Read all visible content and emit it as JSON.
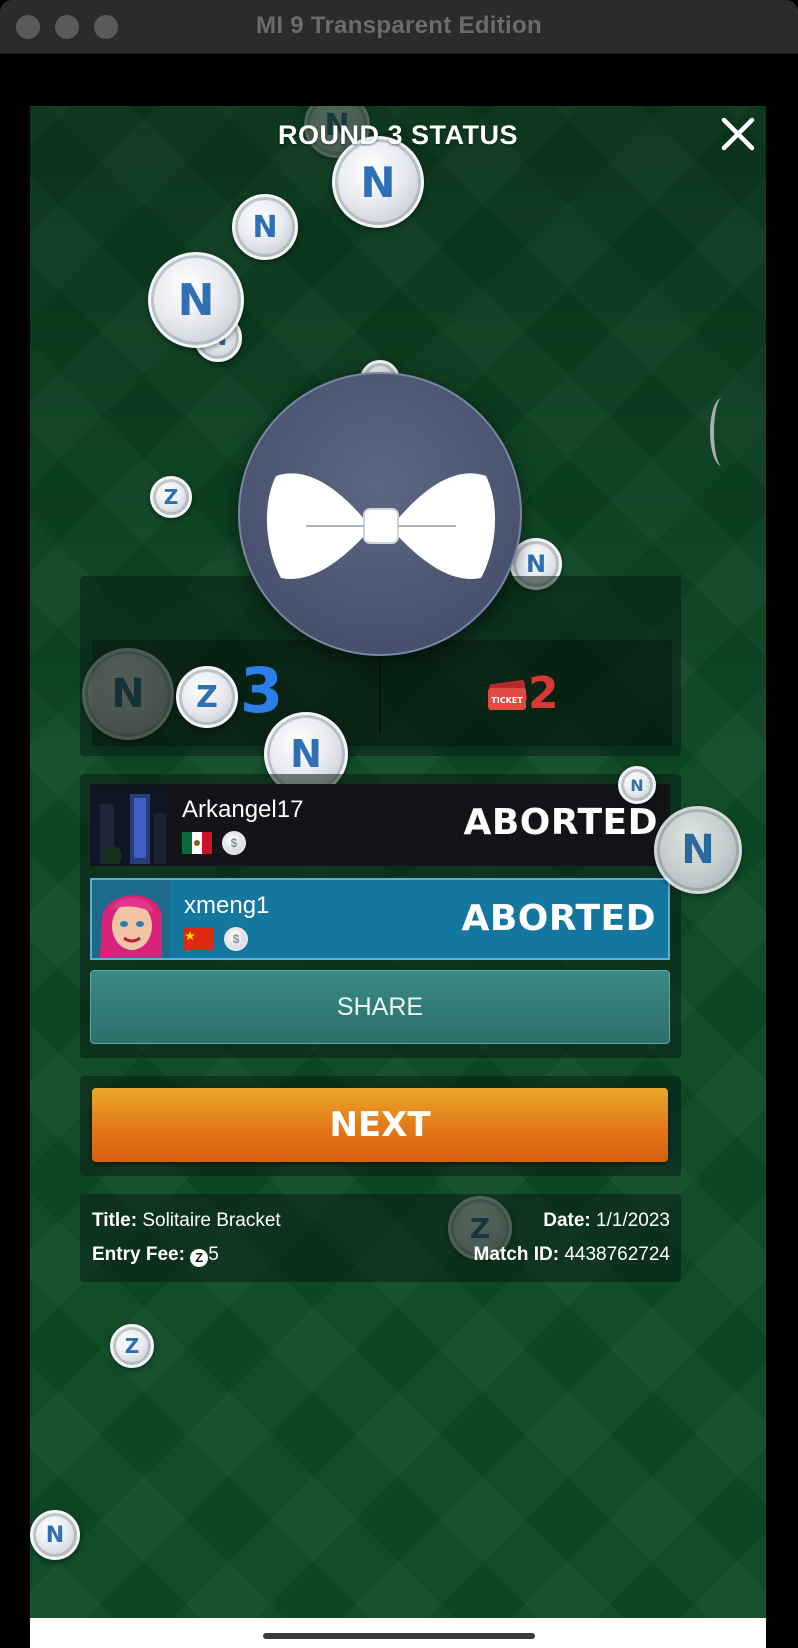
{
  "window": {
    "title": "MI 9 Transparent Edition"
  },
  "header": {
    "title": "ROUND 3 STATUS",
    "close_icon": "close-icon"
  },
  "score": {
    "coins_value": "3",
    "tickets_value": "2",
    "ticket_label": "TICKET",
    "colors": {
      "coins": "#2d7fe8",
      "tickets": "#d43a33"
    }
  },
  "players": [
    {
      "name": "Arkangel17",
      "flag": "mexico-flag",
      "status": "ABORTED"
    },
    {
      "name": "xmeng1",
      "flag": "china-flag",
      "status": "ABORTED"
    }
  ],
  "buttons": {
    "share": "SHARE",
    "next": "NEXT"
  },
  "info": {
    "title_label": "Title:",
    "title_value": "Solitaire Bracket",
    "fee_label": "Entry Fee:",
    "fee_value": "5",
    "date_label": "Date:",
    "date_value": "1/1/2023",
    "match_label": "Match ID:",
    "match_value": "4438762724"
  },
  "colors": {
    "accent_next": "#e47718",
    "share_teal": "#2d6f6b",
    "highlight_row": "#1477a0",
    "felt": "#0d4a25"
  }
}
